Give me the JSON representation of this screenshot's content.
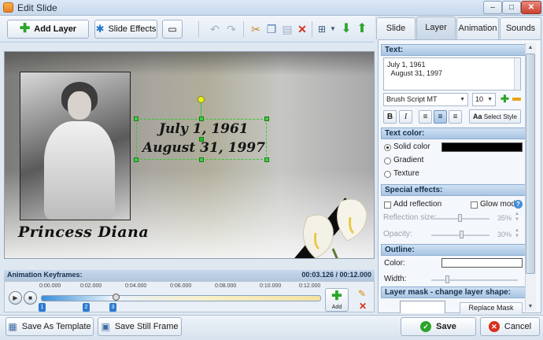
{
  "window": {
    "title": "Edit Slide",
    "minimize": "–",
    "maximize": "□",
    "close": "✕"
  },
  "toolbar": {
    "add_layer": "Add Layer",
    "slide_effects": "Slide Effects"
  },
  "tabs": [
    {
      "label": "Slide"
    },
    {
      "label": "Layer",
      "active": true
    },
    {
      "label": "Animation"
    },
    {
      "label": "Sounds"
    }
  ],
  "preview": {
    "caption": "Princess Diana",
    "date_line_1": "July 1, 1961",
    "date_line_2": "August 31, 1997"
  },
  "keyframes": {
    "header": "Animation Keyframes:",
    "time": "00:03.126 / 00:12.000",
    "ruler": [
      "0:00.000",
      "0:02.000",
      "0:04.000",
      "0:06.000",
      "0:08.000",
      "0:10.000",
      "0:12.000"
    ],
    "markers": [
      "1",
      "2",
      "3"
    ],
    "add_label": "Add"
  },
  "panel": {
    "text_section": "Text:",
    "text_value_line_1": "July 1, 1961",
    "text_value_line_2": "  August 31, 1997",
    "font_family": "Brush Script MT",
    "font_size": "10",
    "bold": "B",
    "italic": "I",
    "select_style": "Select Style",
    "color_section": "Text color:",
    "solid_color": "Solid color",
    "gradient": "Gradient",
    "texture": "Texture",
    "solid_swatch": "#000000",
    "effects_section": "Special effects:",
    "add_reflection": "Add reflection",
    "glow_mode": "Glow mode",
    "reflection_size_label": "Reflection size:",
    "reflection_size_value": "35%",
    "opacity_label": "Opacity:",
    "opacity_value": "30%",
    "outline_section": "Outline:",
    "outline_color_label": "Color:",
    "outline_width_label": "Width:",
    "outline_swatch": "#ffffff",
    "mask_section": "Layer mask - change layer shape:",
    "replace_mask": "Replace Mask"
  },
  "bottom": {
    "save_template": "Save As Template",
    "save_frame": "Save Still Frame",
    "save": "Save",
    "cancel": "Cancel"
  },
  "colors": {
    "accent_green": "#2aa52a",
    "cancel_red": "#d8311e"
  }
}
